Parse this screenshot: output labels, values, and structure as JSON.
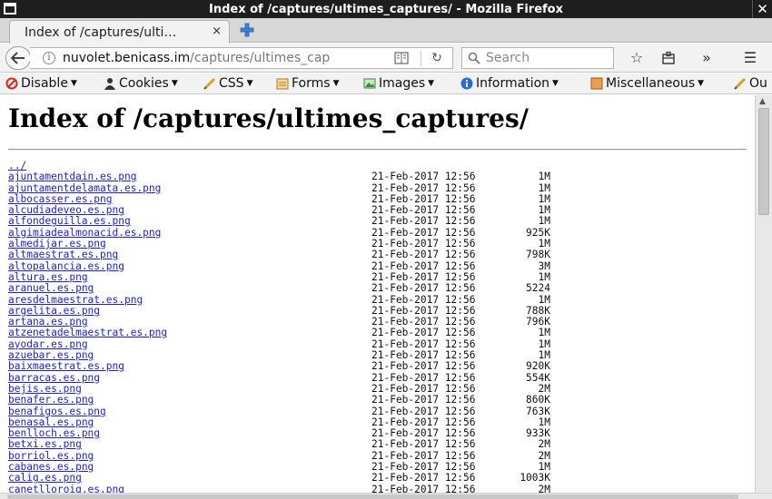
{
  "window": {
    "title": "Index of /captures/ultimes_captures/ - Mozilla Firefox"
  },
  "tab": {
    "title": "Index of /captures/ulti…",
    "close": "×"
  },
  "navbar": {
    "url_host": "nuvolet.benicass.im",
    "url_path": "/captures/ultimes_cap",
    "search_placeholder": "Search"
  },
  "devbar": {
    "items": [
      {
        "label": "Disable",
        "icon": "disable-icon",
        "color": "#d8281e"
      },
      {
        "label": "Cookies",
        "icon": "cookies-icon",
        "color": "#333333"
      },
      {
        "label": "CSS",
        "icon": "css-icon",
        "color": "#e0a020"
      },
      {
        "label": "Forms",
        "icon": "forms-icon",
        "color": "#d09020"
      },
      {
        "label": "Images",
        "icon": "images-icon",
        "color": "#3a8a3a"
      },
      {
        "label": "Information",
        "icon": "information-icon",
        "color": "#2a6ad8"
      },
      {
        "label": "Miscellaneous",
        "icon": "miscellaneous-icon",
        "color": "#d88020"
      },
      {
        "label": "Ou",
        "icon": "outline-icon",
        "color": "#d8a020"
      }
    ]
  },
  "page": {
    "heading": "Index of /captures/ultimes_captures/",
    "parent_link": "../",
    "files": [
      {
        "name": "ajuntamentdain.es.png",
        "date": "21-Feb-2017 12:56",
        "size": "1M"
      },
      {
        "name": "ajuntamentdelamata.es.png",
        "date": "21-Feb-2017 12:56",
        "size": "1M"
      },
      {
        "name": "albocasser.es.png",
        "date": "21-Feb-2017 12:56",
        "size": "1M"
      },
      {
        "name": "alcudiadeveo.es.png",
        "date": "21-Feb-2017 12:56",
        "size": "1M"
      },
      {
        "name": "alfondeguilla.es.png",
        "date": "21-Feb-2017 12:56",
        "size": "1M"
      },
      {
        "name": "algimiadealmonacid.es.png",
        "date": "21-Feb-2017 12:56",
        "size": "925K"
      },
      {
        "name": "almedijar.es.png",
        "date": "21-Feb-2017 12:56",
        "size": "1M"
      },
      {
        "name": "altmaestrat.es.png",
        "date": "21-Feb-2017 12:56",
        "size": "798K"
      },
      {
        "name": "altopalancia.es.png",
        "date": "21-Feb-2017 12:56",
        "size": "3M"
      },
      {
        "name": "altura.es.png",
        "date": "21-Feb-2017 12:56",
        "size": "1M"
      },
      {
        "name": "aranuel.es.png",
        "date": "21-Feb-2017 12:56",
        "size": "5224"
      },
      {
        "name": "aresdelmaestrat.es.png",
        "date": "21-Feb-2017 12:56",
        "size": "1M"
      },
      {
        "name": "argelita.es.png",
        "date": "21-Feb-2017 12:56",
        "size": "788K"
      },
      {
        "name": "artana.es.png",
        "date": "21-Feb-2017 12:56",
        "size": "796K"
      },
      {
        "name": "atzenetadelmaestrat.es.png",
        "date": "21-Feb-2017 12:56",
        "size": "1M"
      },
      {
        "name": "ayodar.es.png",
        "date": "21-Feb-2017 12:56",
        "size": "1M"
      },
      {
        "name": "azuebar.es.png",
        "date": "21-Feb-2017 12:56",
        "size": "1M"
      },
      {
        "name": "baixmaestrat.es.png",
        "date": "21-Feb-2017 12:56",
        "size": "920K"
      },
      {
        "name": "barracas.es.png",
        "date": "21-Feb-2017 12:56",
        "size": "554K"
      },
      {
        "name": "bejis.es.png",
        "date": "21-Feb-2017 12:56",
        "size": "2M"
      },
      {
        "name": "benafer.es.png",
        "date": "21-Feb-2017 12:56",
        "size": "860K"
      },
      {
        "name": "benafigos.es.png",
        "date": "21-Feb-2017 12:56",
        "size": "763K"
      },
      {
        "name": "benasal.es.png",
        "date": "21-Feb-2017 12:56",
        "size": "1M"
      },
      {
        "name": "benlloch.es.png",
        "date": "21-Feb-2017 12:56",
        "size": "933K"
      },
      {
        "name": "betxi.es.png",
        "date": "21-Feb-2017 12:56",
        "size": "2M"
      },
      {
        "name": "borriol.es.png",
        "date": "21-Feb-2017 12:56",
        "size": "2M"
      },
      {
        "name": "cabanes.es.png",
        "date": "21-Feb-2017 12:56",
        "size": "1M"
      },
      {
        "name": "calig.es.png",
        "date": "21-Feb-2017 12:56",
        "size": "1003K"
      },
      {
        "name": "canetlloroig.es.png",
        "date": "21-Feb-2017 12:56",
        "size": "2M"
      }
    ]
  }
}
